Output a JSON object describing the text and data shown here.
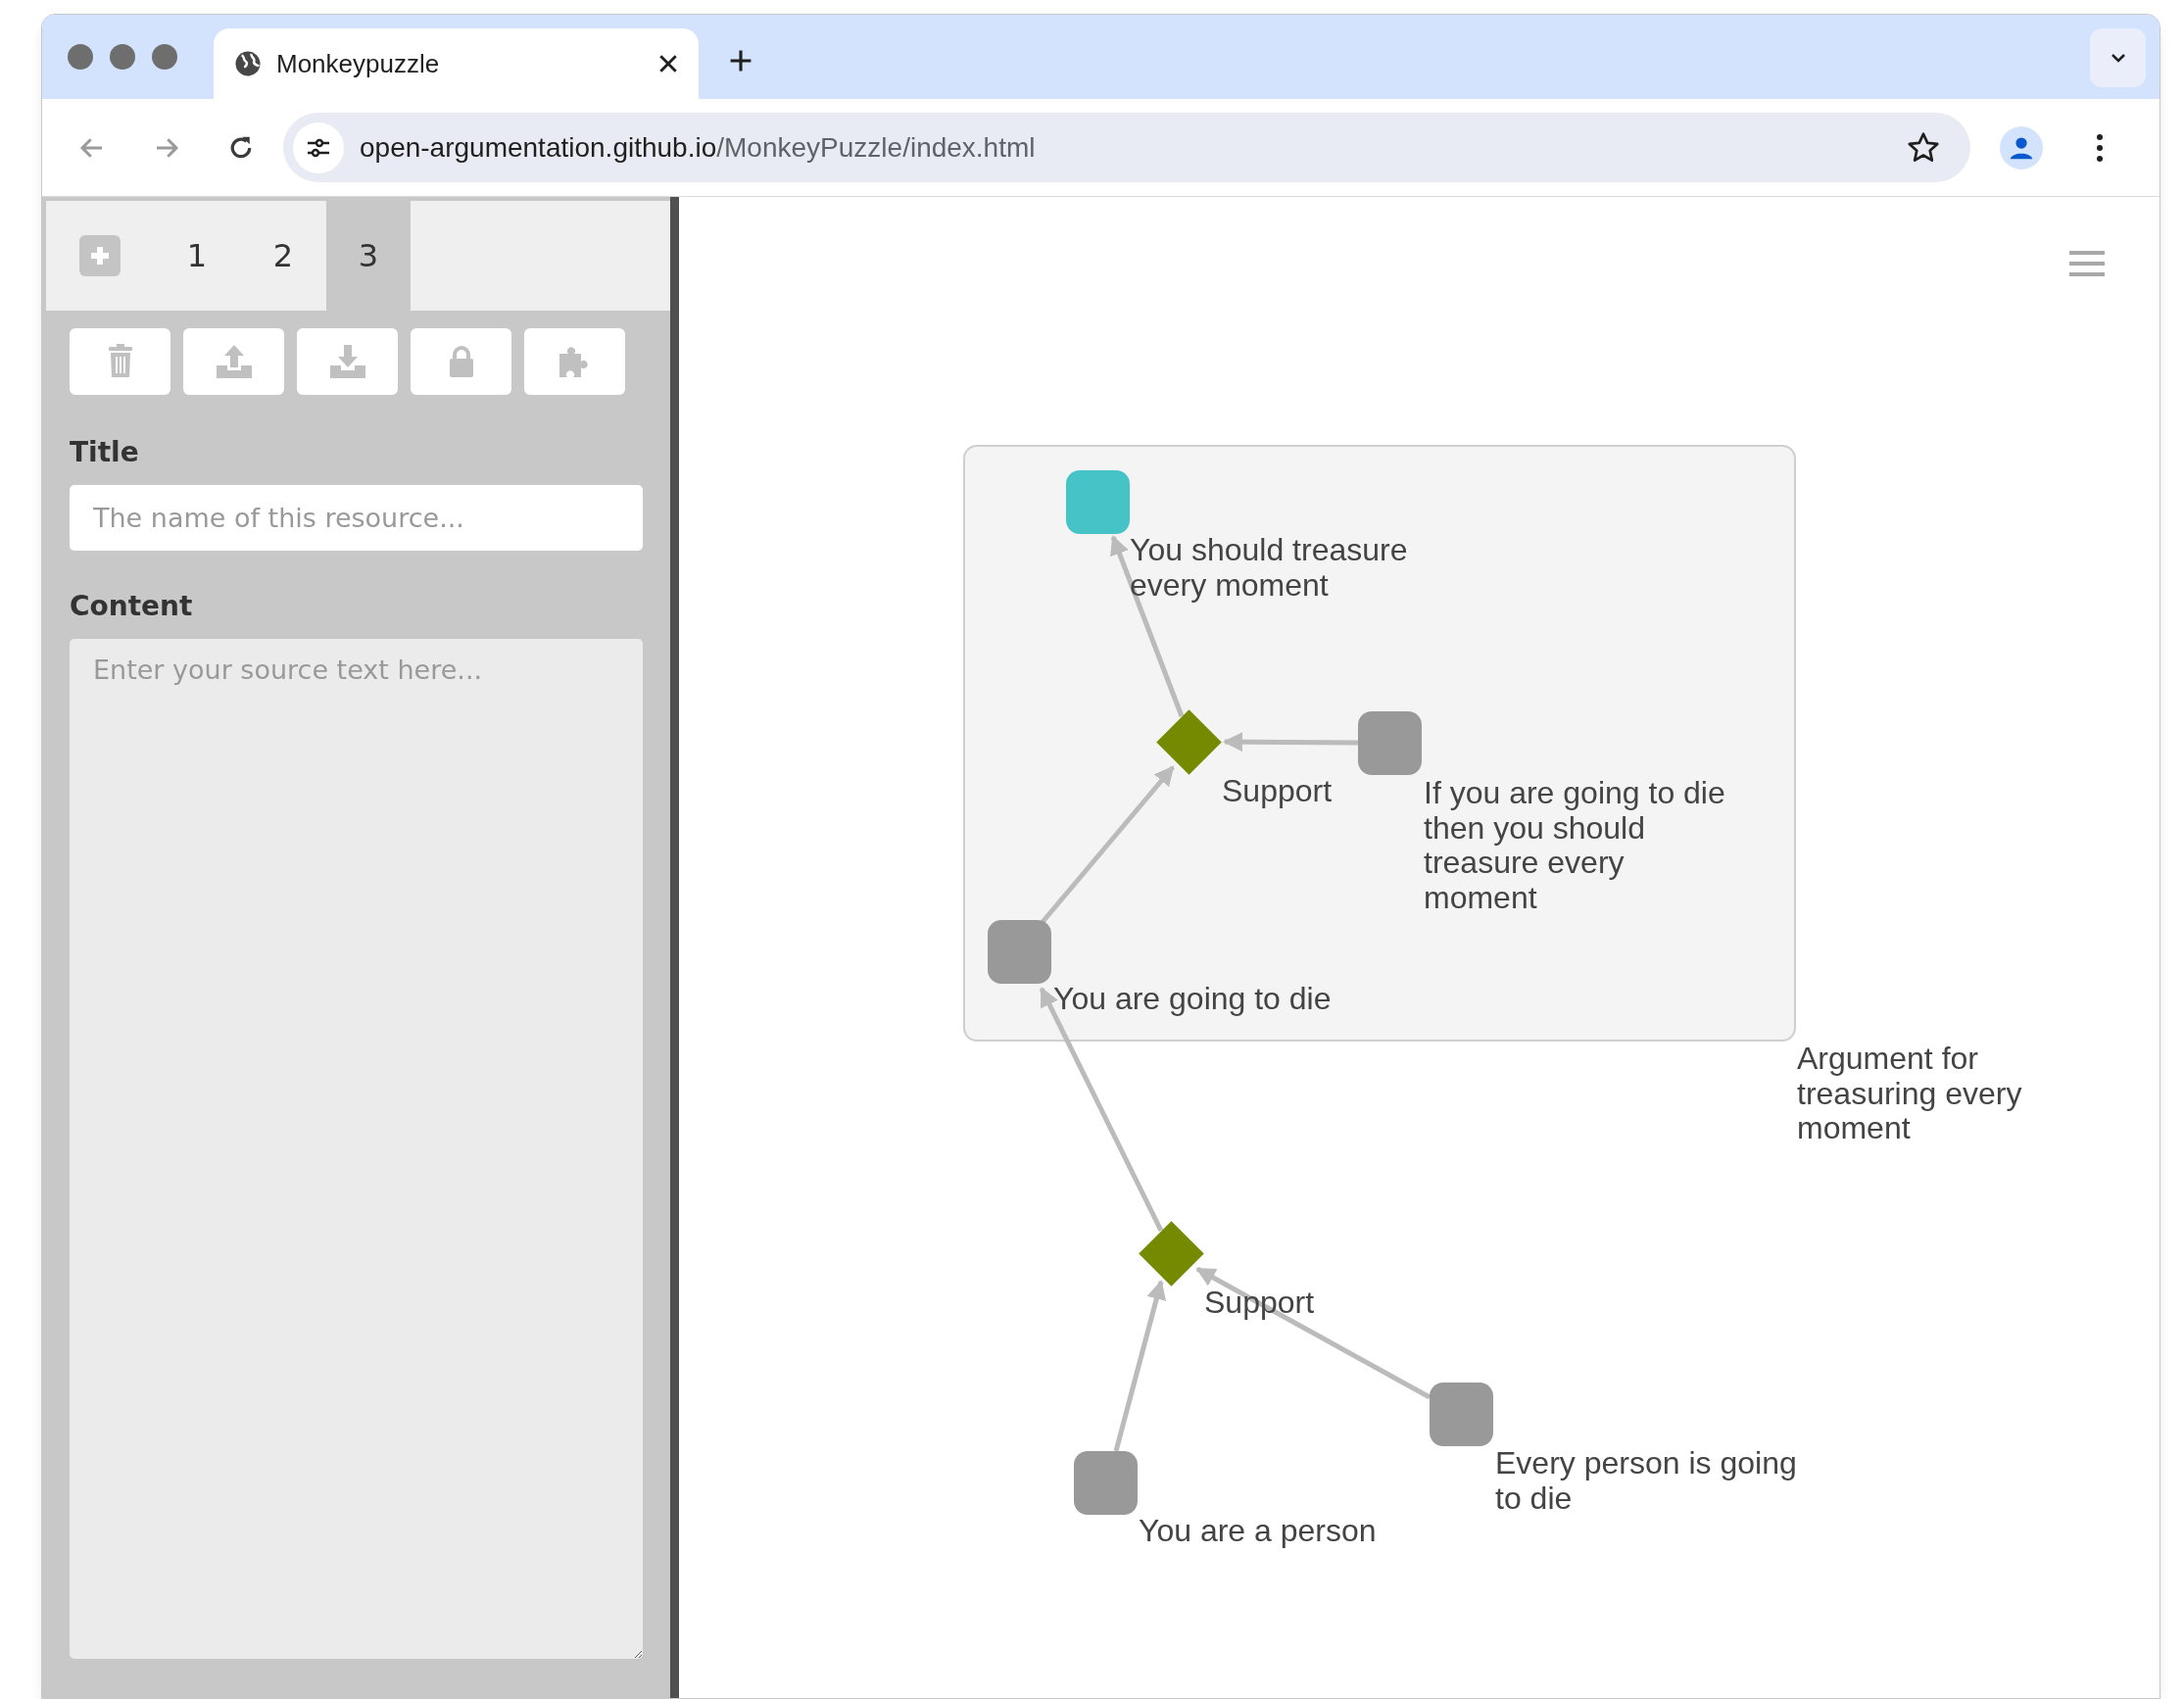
{
  "browser": {
    "tab_title": "Monkeypuzzle",
    "url_host": "open-argumentation.github.io",
    "url_path": "/MonkeyPuzzle/index.html"
  },
  "sidebar": {
    "tabs": [
      {
        "label": "1",
        "selected": false
      },
      {
        "label": "2",
        "selected": false
      },
      {
        "label": "3",
        "selected": true
      }
    ],
    "title_label": "Title",
    "title_placeholder": "The name of this resource...",
    "content_label": "Content",
    "content_placeholder": "Enter your source text here..."
  },
  "graph": {
    "group": {
      "label_lines": [
        "Argument for",
        "treasuring every",
        "moment"
      ]
    },
    "nodes": [
      {
        "kind": "claim",
        "color": "#45c3c6",
        "label_lines": [
          "You should treasure",
          "every moment"
        ]
      },
      {
        "kind": "support",
        "label_lines": [
          "Support"
        ]
      },
      {
        "kind": "claim",
        "color": "#999999",
        "label_lines": [
          "If you are going to die",
          "then you should",
          "treasure every",
          "moment"
        ]
      },
      {
        "kind": "claim",
        "color": "#999999",
        "label_lines": [
          "You are going to die"
        ]
      },
      {
        "kind": "support",
        "label_lines": [
          "Support"
        ]
      },
      {
        "kind": "claim",
        "color": "#999999",
        "label_lines": [
          "Every person is going",
          "to die"
        ]
      },
      {
        "kind": "claim",
        "color": "#999999",
        "label_lines": [
          "You are a person"
        ]
      }
    ]
  }
}
